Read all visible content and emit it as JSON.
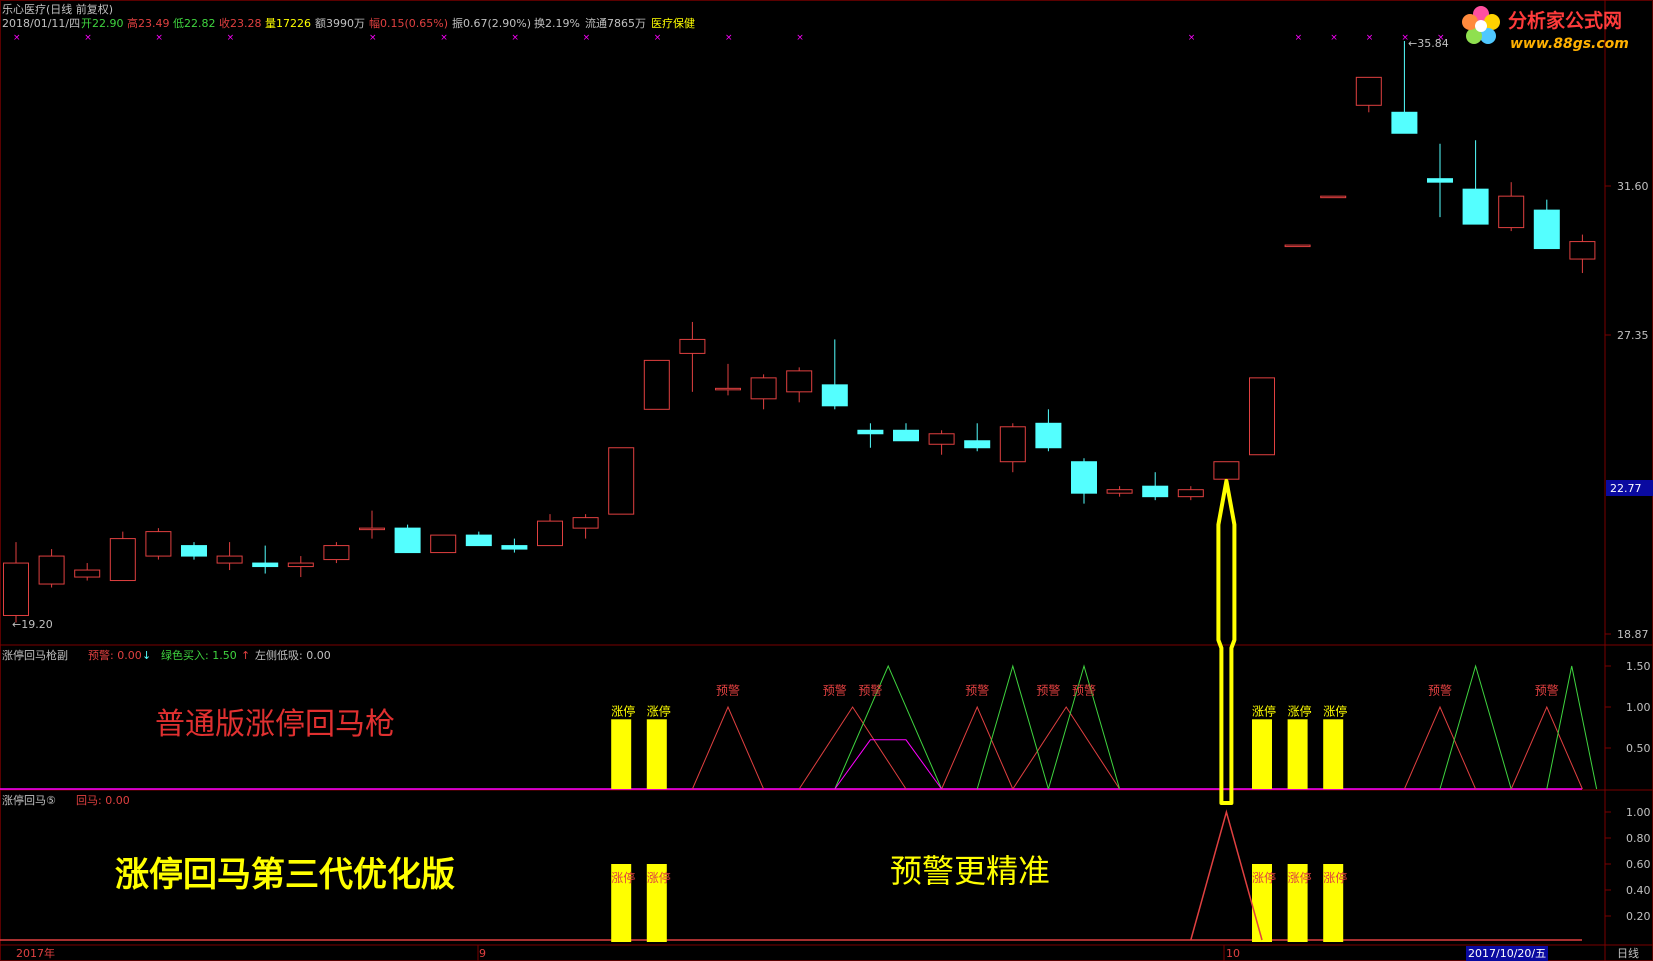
{
  "header": {
    "stock_name": "乐心医疗(日线 前复权)",
    "date": "2018/01/11/四",
    "open": "开22.90",
    "high": "高23.49",
    "low": "低22.82",
    "close": "收23.28",
    "volume": "量17226",
    "amount": "额3990万",
    "change": "幅0.15(0.65%)",
    "amplitude": "振0.67(2.90%)",
    "turnover": "换2.19%",
    "float": "流通7865万",
    "sector": "医疗保健"
  },
  "logo": {
    "brand": "分析家公式网",
    "url": "www.88gs.com"
  },
  "colors": {
    "up": "#e04040",
    "down": "#54ffff",
    "yellow": "#ffff00",
    "axis": "#c0c0c0",
    "magenta": "#ff00ff",
    "green": "#3fd43f"
  },
  "price_axis": {
    "ticks": [
      "31.60",
      "27.35",
      "18.87"
    ],
    "current": "22.77"
  },
  "annotations": {
    "low_price": "19.20",
    "high_price": "35.84"
  },
  "panel1": {
    "title": "涨停回马枪副",
    "warn_label": "预警: 0.00",
    "green_buy_label": "绿色买入: 1.50",
    "left_low_label": "左侧低吸: 0.00",
    "overlay_text": "普通版涨停回马枪",
    "y_ticks": [
      "1.50",
      "1.00",
      "0.50"
    ],
    "limit_up_label": "涨停",
    "warn_text": "预警"
  },
  "panel2": {
    "title": "涨停回马⑤",
    "huima_label": "回马: 0.00",
    "overlay_text_1": "涨停回马第三代优化版",
    "overlay_text_2": "预警更精准",
    "y_ticks": [
      "1.00",
      "0.80",
      "0.60",
      "0.40",
      "0.20"
    ],
    "limit_up_label": "涨停"
  },
  "x_axis": {
    "labels": [
      "2017年",
      "9",
      "10"
    ],
    "current_date": "2017/10/20/五",
    "period": "日线"
  },
  "chart_data": {
    "type": "candlestick",
    "ylim": [
      18.87,
      35.84
    ],
    "candles": [
      {
        "o": 19.4,
        "h": 21.5,
        "l": 19.2,
        "c": 20.9
      },
      {
        "o": 20.3,
        "h": 21.3,
        "l": 20.2,
        "c": 21.1
      },
      {
        "o": 20.5,
        "h": 20.9,
        "l": 20.4,
        "c": 20.7
      },
      {
        "o": 20.4,
        "h": 21.8,
        "l": 20.4,
        "c": 21.6
      },
      {
        "o": 21.1,
        "h": 21.9,
        "l": 21.0,
        "c": 21.8
      },
      {
        "o": 21.4,
        "h": 21.5,
        "l": 21.0,
        "c": 21.1
      },
      {
        "o": 20.9,
        "h": 21.5,
        "l": 20.7,
        "c": 21.1
      },
      {
        "o": 20.9,
        "h": 21.4,
        "l": 20.6,
        "c": 20.8
      },
      {
        "o": 20.8,
        "h": 21.1,
        "l": 20.5,
        "c": 20.9
      },
      {
        "o": 21.0,
        "h": 21.5,
        "l": 20.9,
        "c": 21.4
      },
      {
        "o": 21.9,
        "h": 22.4,
        "l": 21.6,
        "c": 21.9
      },
      {
        "o": 21.9,
        "h": 22.0,
        "l": 21.3,
        "c": 21.2
      },
      {
        "o": 21.2,
        "h": 21.7,
        "l": 21.2,
        "c": 21.7
      },
      {
        "o": 21.7,
        "h": 21.8,
        "l": 21.4,
        "c": 21.4
      },
      {
        "o": 21.4,
        "h": 21.6,
        "l": 21.2,
        "c": 21.3
      },
      {
        "o": 21.4,
        "h": 22.3,
        "l": 21.4,
        "c": 22.1
      },
      {
        "o": 21.9,
        "h": 22.3,
        "l": 21.6,
        "c": 22.2
      },
      {
        "o": 22.3,
        "h": 24.2,
        "l": 22.3,
        "c": 24.2
      },
      {
        "o": 25.3,
        "h": 26.7,
        "l": 25.3,
        "c": 26.7
      },
      {
        "o": 26.9,
        "h": 27.8,
        "l": 25.8,
        "c": 27.3
      },
      {
        "o": 25.9,
        "h": 26.6,
        "l": 25.7,
        "c": 25.9
      },
      {
        "o": 25.6,
        "h": 26.3,
        "l": 25.3,
        "c": 26.2
      },
      {
        "o": 25.8,
        "h": 26.5,
        "l": 25.5,
        "c": 26.4
      },
      {
        "o": 26.0,
        "h": 27.3,
        "l": 25.3,
        "c": 25.4
      },
      {
        "o": 24.7,
        "h": 24.9,
        "l": 24.2,
        "c": 24.6
      },
      {
        "o": 24.7,
        "h": 24.9,
        "l": 24.4,
        "c": 24.4
      },
      {
        "o": 24.3,
        "h": 24.7,
        "l": 24.0,
        "c": 24.6
      },
      {
        "o": 24.4,
        "h": 24.9,
        "l": 24.1,
        "c": 24.2
      },
      {
        "o": 23.8,
        "h": 24.9,
        "l": 23.5,
        "c": 24.8
      },
      {
        "o": 24.9,
        "h": 25.3,
        "l": 24.1,
        "c": 24.2
      },
      {
        "o": 23.8,
        "h": 23.9,
        "l": 22.6,
        "c": 22.9
      },
      {
        "o": 22.9,
        "h": 23.1,
        "l": 22.8,
        "c": 23.0
      },
      {
        "o": 23.1,
        "h": 23.5,
        "l": 22.7,
        "c": 22.8
      },
      {
        "o": 22.8,
        "h": 23.1,
        "l": 22.7,
        "c": 23.0
      },
      {
        "o": 23.3,
        "h": 23.8,
        "l": 23.1,
        "c": 23.8
      },
      {
        "o": 24.0,
        "h": 26.2,
        "l": 24.0,
        "c": 26.2
      },
      {
        "o": 30.0,
        "h": 30.0,
        "l": 30.0,
        "c": 30.0
      },
      {
        "o": 31.4,
        "h": 31.4,
        "l": 31.4,
        "c": 31.4
      },
      {
        "o": 34.0,
        "h": 34.8,
        "l": 33.8,
        "c": 34.8
      },
      {
        "o": 33.8,
        "h": 35.84,
        "l": 33.7,
        "c": 33.2
      },
      {
        "o": 31.9,
        "h": 32.9,
        "l": 30.8,
        "c": 31.8
      },
      {
        "o": 31.6,
        "h": 33.0,
        "l": 30.9,
        "c": 30.6
      },
      {
        "o": 30.5,
        "h": 31.8,
        "l": 30.4,
        "c": 31.4
      },
      {
        "o": 31.0,
        "h": 31.3,
        "l": 29.9,
        "c": 29.9
      },
      {
        "o": 29.6,
        "h": 30.3,
        "l": 29.2,
        "c": 30.1
      }
    ],
    "panel1_yellow_bars": [
      17,
      18,
      35,
      36,
      37
    ],
    "panel1_warn_bars": [
      20,
      23,
      24,
      27,
      29,
      30,
      40,
      43
    ],
    "panel2_yellow_bars": [
      17,
      18,
      35,
      36,
      37
    ],
    "panel2_spike_bar": 34
  }
}
